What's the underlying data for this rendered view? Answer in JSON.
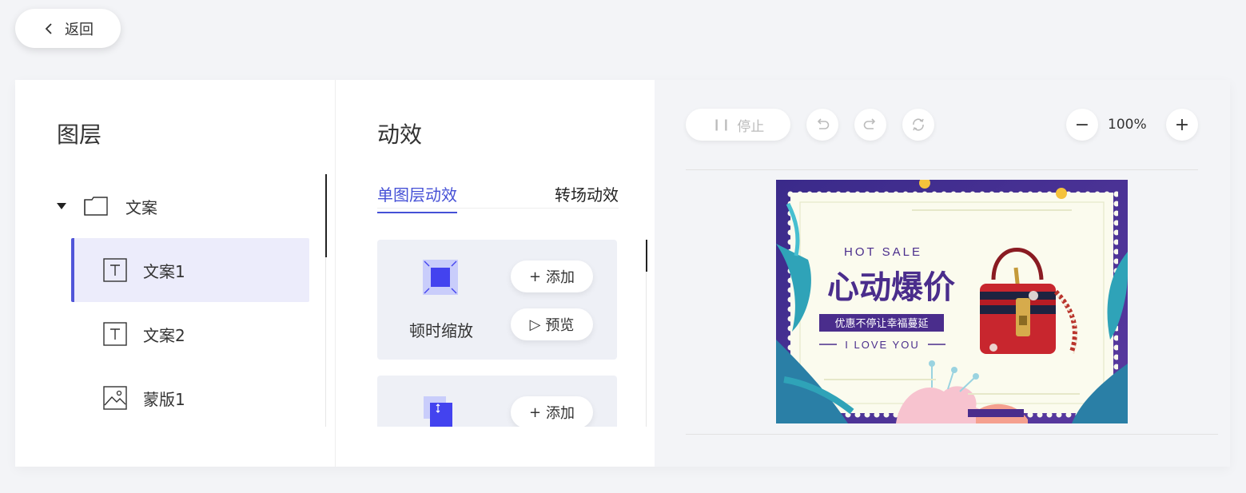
{
  "back": {
    "label": "返回"
  },
  "layers_panel": {
    "title": "图层",
    "folder": {
      "label": "文案"
    },
    "items": [
      {
        "label": "文案1",
        "icon": "text-icon",
        "active": true
      },
      {
        "label": "文案2",
        "icon": "text-icon",
        "active": false
      },
      {
        "label": "蒙版1",
        "icon": "image-icon",
        "active": false
      }
    ]
  },
  "effects_panel": {
    "title": "动效",
    "tabs": [
      {
        "label": "单图层动效",
        "active": true
      },
      {
        "label": "转场动效",
        "active": false
      }
    ],
    "cards": [
      {
        "name": "顿时缩放",
        "add_label": "添加",
        "preview_label": "预览"
      },
      {
        "name": "",
        "add_label": "添加"
      }
    ]
  },
  "preview_panel": {
    "stop_label": "停止",
    "zoom": "100%",
    "banner": {
      "hot_sale": "HOT SALE",
      "headline": "心动爆价",
      "tagline": "优惠不停让幸福蔓延",
      "love": "I LOVE YOU"
    }
  },
  "colors": {
    "accent": "#4550d6",
    "active_bg": "#ececfb",
    "banner_purple": "#4a2d8c",
    "banner_cream": "#fbfbee",
    "bag_red": "#c8262e"
  }
}
